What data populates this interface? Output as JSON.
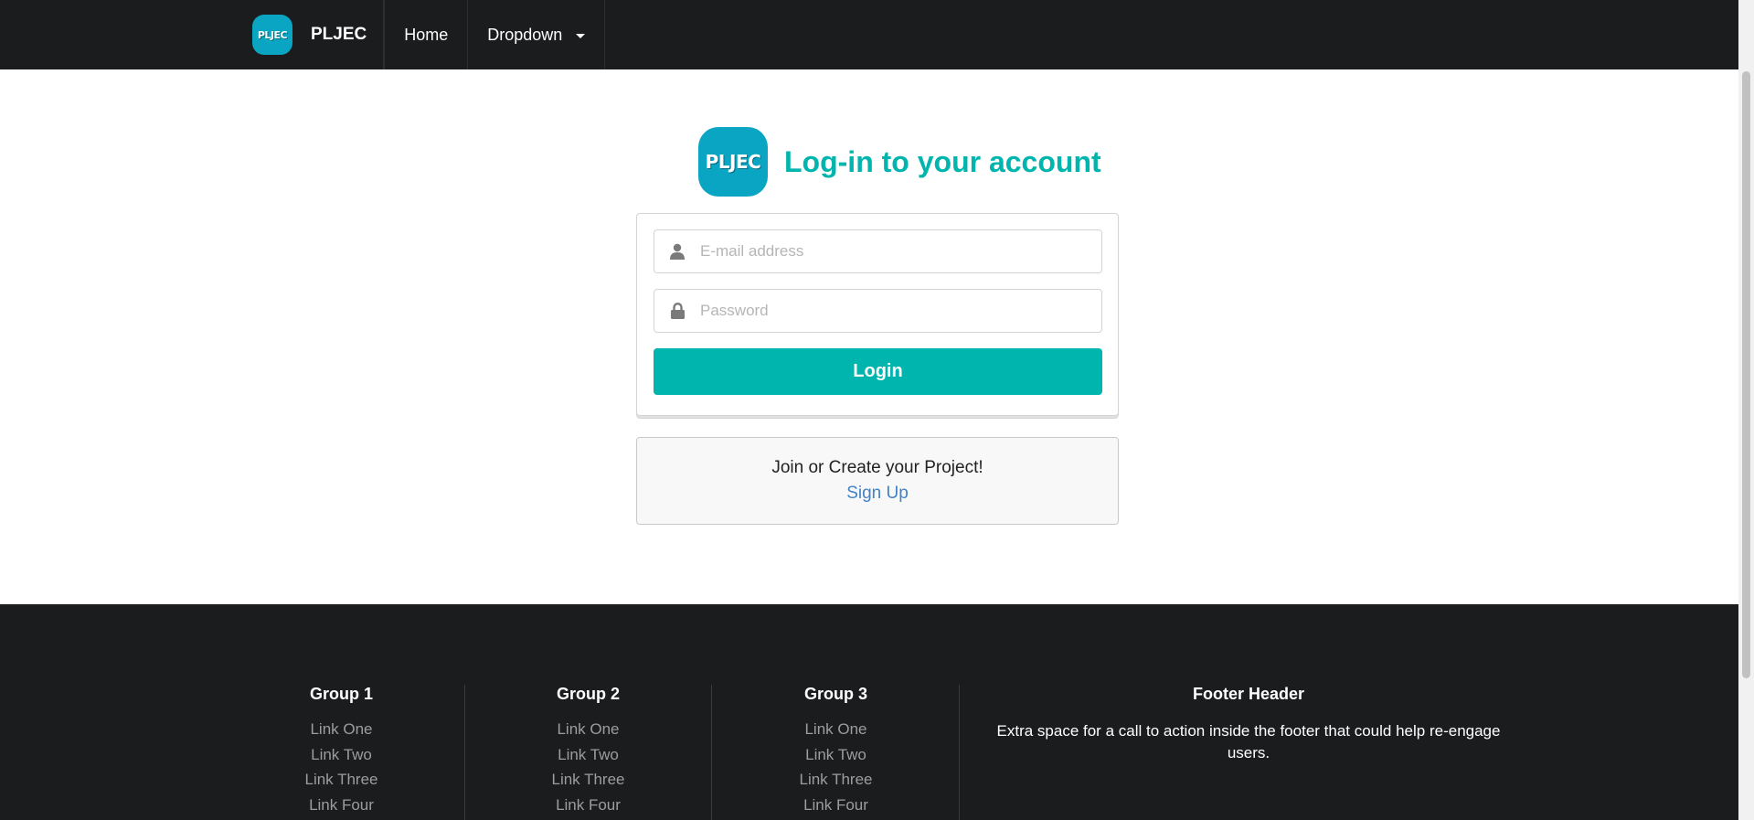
{
  "nav": {
    "logo_text": "PLJEC",
    "brand_name": "PLJEC",
    "home": "Home",
    "dropdown": "Dropdown"
  },
  "header": {
    "logo_text": "PLJEC",
    "title": "Log-in to your account"
  },
  "form": {
    "email_placeholder": "E-mail address",
    "password_placeholder": "Password",
    "email_value": "",
    "password_value": "",
    "login_label": "Login"
  },
  "message": {
    "text": "Join or Create your Project!",
    "signup_label": "Sign Up"
  },
  "footer": {
    "groups": [
      {
        "title": "Group 1",
        "links": [
          "Link One",
          "Link Two",
          "Link Three",
          "Link Four"
        ]
      },
      {
        "title": "Group 2",
        "links": [
          "Link One",
          "Link Two",
          "Link Three",
          "Link Four"
        ]
      },
      {
        "title": "Group 3",
        "links": [
          "Link One",
          "Link Two",
          "Link Three",
          "Link Four"
        ]
      }
    ],
    "header": "Footer Header",
    "text": "Extra space for a call to action inside the footer that could help re-engage users."
  },
  "colors": {
    "accent": "#00b5ad",
    "logo_bg": "#09a5c3",
    "nav_bg": "#1b1c1d",
    "link": "#4183c4"
  },
  "icons": {
    "email_field": "user-icon",
    "password_field": "lock-icon",
    "dropdown": "caret-down-icon"
  }
}
